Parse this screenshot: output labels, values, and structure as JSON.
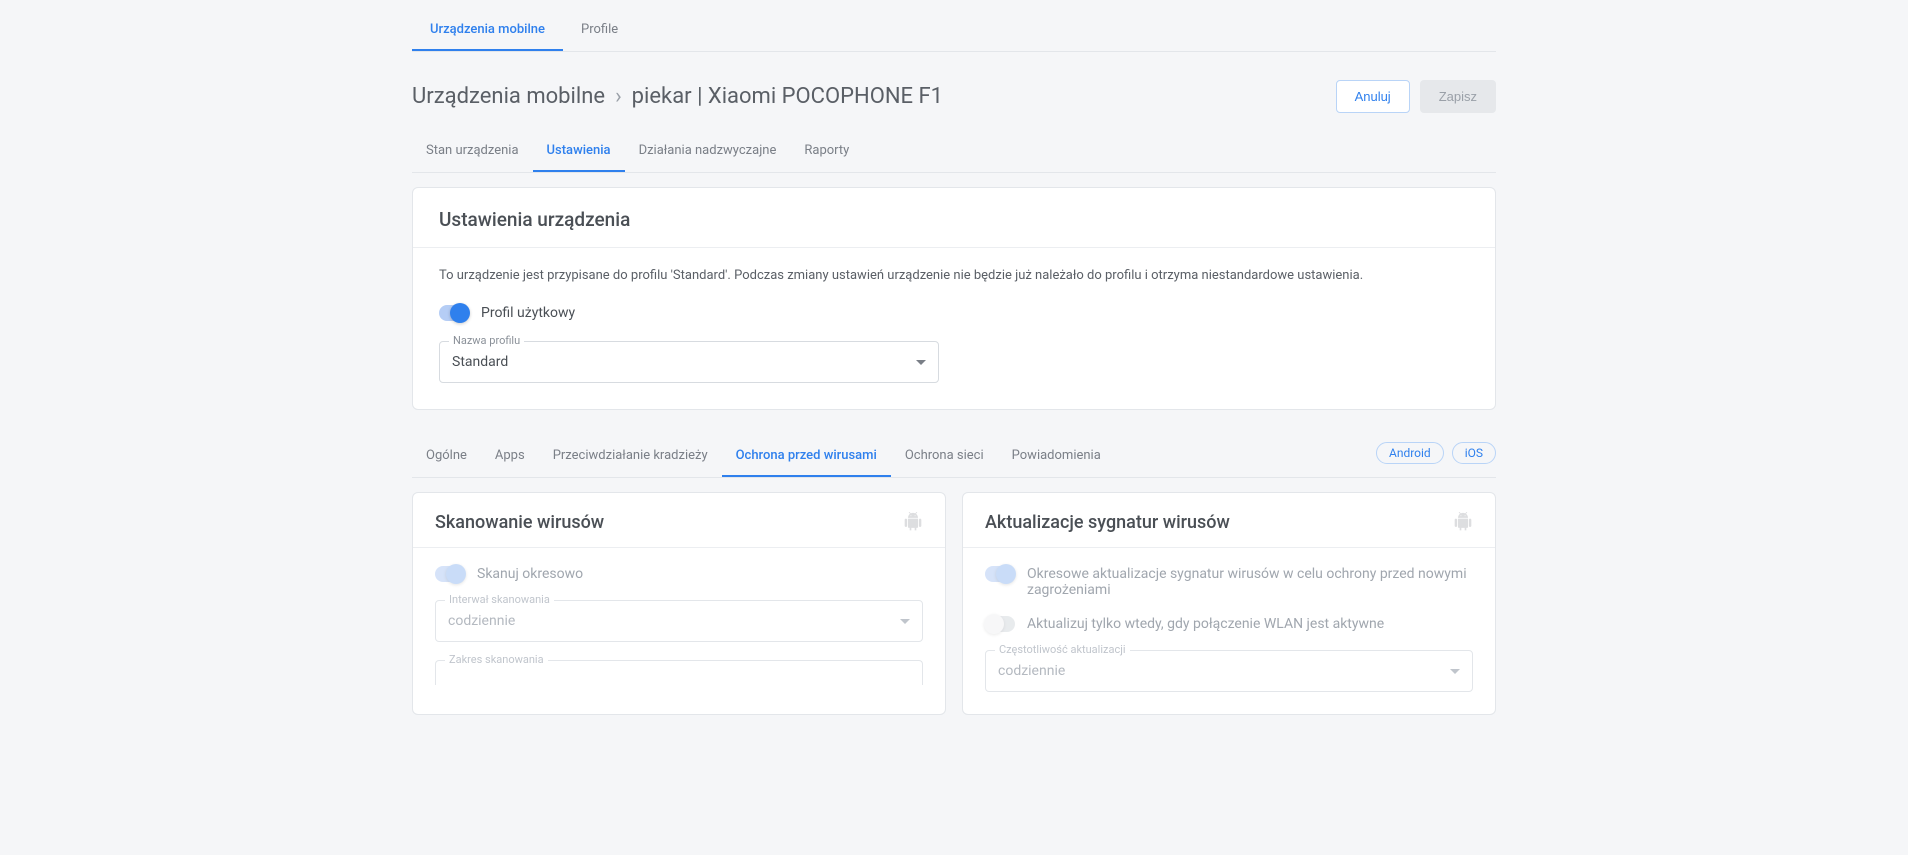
{
  "topTabs": {
    "mobile": "Urządzenia mobilne",
    "profiles": "Profile"
  },
  "breadcrumb": {
    "root": "Urządzenia mobilne",
    "device": "piekar | Xiaomi POCOPHONE F1"
  },
  "actions": {
    "cancel": "Anuluj",
    "save": "Zapisz"
  },
  "deviceTabs": {
    "status": "Stan urządzenia",
    "settings": "Ustawienia",
    "emergency": "Działania nadzwyczajne",
    "reports": "Raporty"
  },
  "settingsCard": {
    "title": "Ustawienia urządzenia",
    "desc": "To urządzenie jest przypisane do profilu 'Standard'. Podczas zmiany ustawień urządzenie nie będzie już należało do profilu i otrzyma niestandardowe ustawienia.",
    "toggleLabel": "Profil użytkowy",
    "profileField": {
      "label": "Nazwa profilu",
      "value": "Standard"
    }
  },
  "categoryTabs": {
    "general": "Ogólne",
    "apps": "Apps",
    "antitheft": "Przeciwdziałanie kradzieży",
    "virus": "Ochrona przed wirusami",
    "network": "Ochrona sieci",
    "notifications": "Powiadomienia"
  },
  "platforms": {
    "android": "Android",
    "ios": "iOS"
  },
  "scanPanel": {
    "title": "Skanowanie wirusów",
    "toggleLabel": "Skanuj okresowo",
    "intervalField": {
      "label": "Interwał skanowania",
      "value": "codziennie"
    },
    "scopeField": {
      "label": "Zakres skanowania"
    }
  },
  "updatePanel": {
    "title": "Aktualizacje sygnatur wirusów",
    "toggle1Label": "Okresowe aktualizacje sygnatur wirusów w celu ochrony przed nowymi zagrożeniami",
    "toggle2Label": "Aktualizuj tylko wtedy, gdy połączenie WLAN jest aktywne",
    "freqField": {
      "label": "Częstotliwość aktualizacji",
      "value": "codziennie"
    }
  }
}
